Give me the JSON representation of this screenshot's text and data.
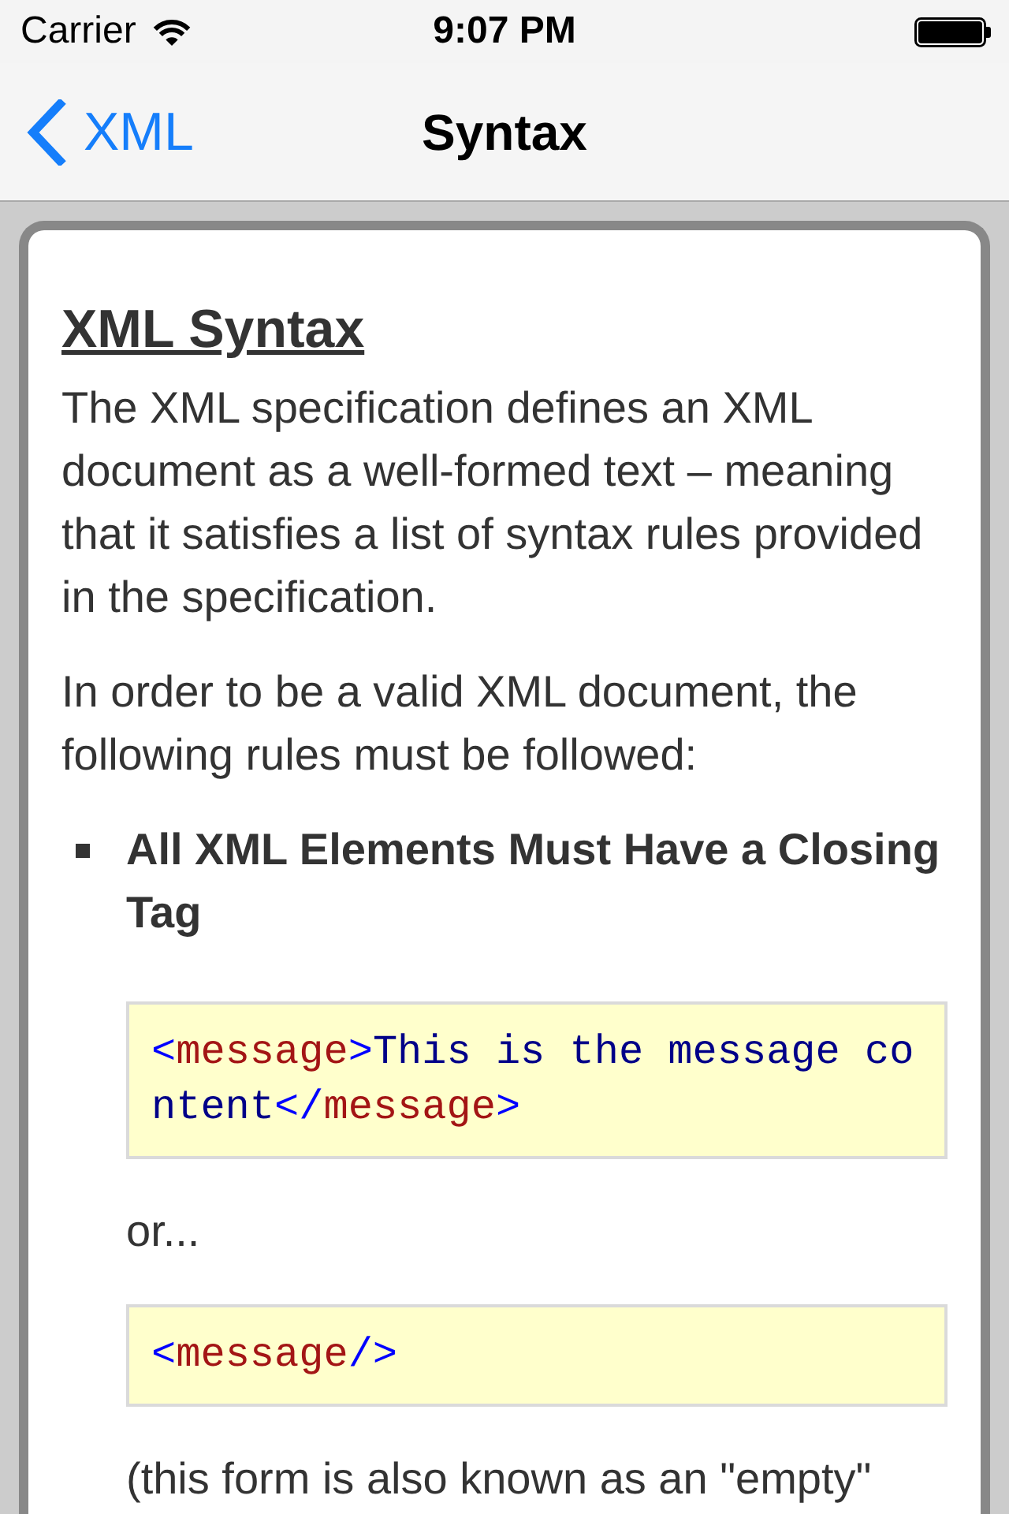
{
  "status_bar": {
    "carrier": "Carrier",
    "time": "9:07 PM"
  },
  "nav_bar": {
    "back": "XML",
    "title": "Syntax"
  },
  "article": {
    "heading": "XML Syntax",
    "blocks": [
      {
        "kind": "paragraph",
        "text": "The XML specification defines an XML document as a well-formed text – meaning that it satisfies a list of syntax rules provided in the specification."
      },
      {
        "kind": "paragraph",
        "text": "In order to be a valid XML document, the following rules must be followed:"
      },
      {
        "kind": "list",
        "items": [
          {
            "title": "All XML Elements Must Have a Closing Tag",
            "blocks": [
              {
                "kind": "code",
                "tokens": [
                  {
                    "kind": "punct",
                    "text": "<"
                  },
                  {
                    "kind": "tag",
                    "text": "message"
                  },
                  {
                    "kind": "punct",
                    "text": ">"
                  },
                  {
                    "kind": "text",
                    "text": "This is the message content"
                  },
                  {
                    "kind": "punct",
                    "text": "</"
                  },
                  {
                    "kind": "tag",
                    "text": "message"
                  },
                  {
                    "kind": "punct",
                    "text": ">"
                  }
                ]
              },
              {
                "kind": "paragraph",
                "text": "or..."
              },
              {
                "kind": "code",
                "tokens": [
                  {
                    "kind": "punct",
                    "text": "<"
                  },
                  {
                    "kind": "tag",
                    "text": "message"
                  },
                  {
                    "kind": "punct",
                    "text": "/>"
                  }
                ]
              },
              {
                "kind": "paragraph",
                "text": "(this form is also known as an \"empty\""
              }
            ]
          }
        ]
      }
    ]
  }
}
